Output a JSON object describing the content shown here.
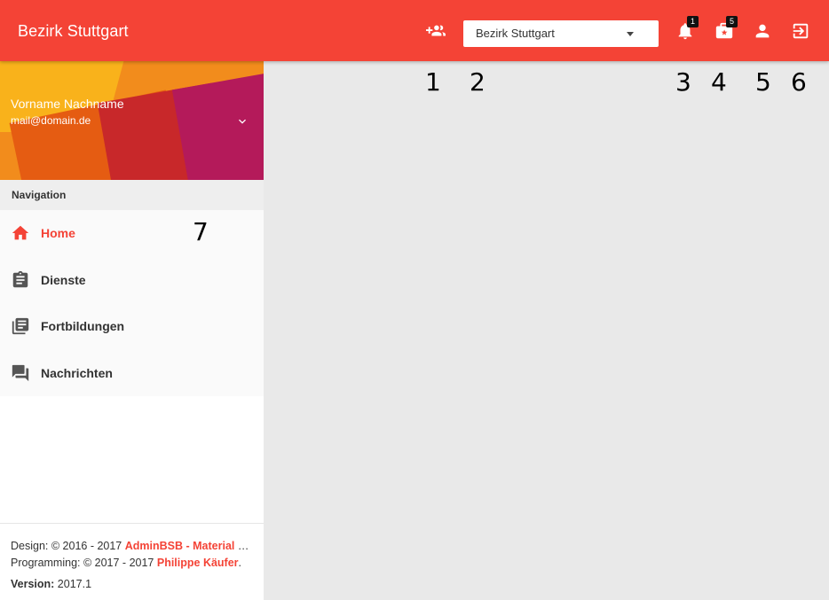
{
  "app": {
    "title": "Bezirk Stuttgart"
  },
  "topbar": {
    "district_select": {
      "value": "Bezirk Stuttgart"
    },
    "icons": {
      "add_group": "group-add-icon",
      "notifications": {
        "icon": "bell-icon",
        "badge": "1"
      },
      "invitations": {
        "icon": "stars-card-icon",
        "badge": "5"
      },
      "profile": "person-icon",
      "logout": "exit-to-app-icon"
    },
    "accent_color": "#f44336"
  },
  "annotations": [
    "1",
    "2",
    "3",
    "4",
    "5",
    "6",
    "7"
  ],
  "user": {
    "name": "Vorname Nachname",
    "email": "mail@domain.de"
  },
  "sidebar": {
    "section_header": "Navigation",
    "items": [
      {
        "label": "Home",
        "icon": "home-icon",
        "active": true
      },
      {
        "label": "Dienste",
        "icon": "clipboard-icon",
        "active": false
      },
      {
        "label": "Fortbildungen",
        "icon": "library-books-icon",
        "active": false
      },
      {
        "label": "Nachrichten",
        "icon": "forum-icon",
        "active": false
      }
    ]
  },
  "footer": {
    "design_prefix": "Design: © 2016 - 2017 ",
    "design_link": "AdminBSB - Material Design",
    "programming_prefix": "Programming: © 2017 - 2017 ",
    "programming_link": "Philippe Käufer",
    "programming_suffix": ".",
    "version_label": "Version:",
    "version_value": " 2017.1"
  }
}
